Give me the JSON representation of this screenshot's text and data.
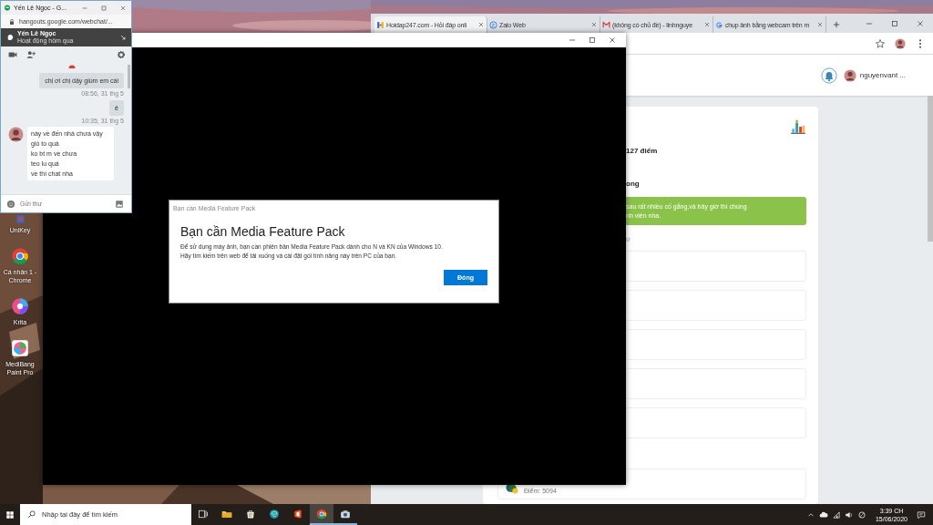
{
  "desktop": {
    "icons": [
      {
        "kind": "unikey",
        "label": "UniKey"
      },
      {
        "kind": "chrome",
        "label": "Cá nhân 1 - Chrome"
      },
      {
        "kind": "krita",
        "label": "Krita"
      },
      {
        "kind": "medibang",
        "label": "MediBang Paint Pro"
      }
    ]
  },
  "browser": {
    "tabs": [
      {
        "kind": "hoidap",
        "title": "Hoidap247.com - Hỏi đáp onli",
        "selected": true
      },
      {
        "kind": "zalo",
        "title": "Zalo Web",
        "selected": false
      },
      {
        "kind": "gmail",
        "title": "(không có chủ đề) - linhnguye",
        "selected": false
      },
      {
        "kind": "google",
        "title": "chụp ảnh bằng webcam trên m",
        "selected": false
      }
    ],
    "page": {
      "user_name": "nguyenvant ...",
      "score": "127 điểm",
      "heading": "ong",
      "alert_lines": [
        "sau rất nhiều cố gắng,và bây giờ thì chúng",
        "nh viên nha."
      ],
      "note": "ứ",
      "points": "Điểm: 5094"
    }
  },
  "camera": {
    "dialog": {
      "caption": "Bạn cần Media Feature Pack",
      "title": "Bạn cần Media Feature Pack",
      "body_lines": [
        "Để sử dụng máy ảnh, bạn cần phiên bản Media Feature Pack dành cho N và KN của Windows 10.",
        "Hãy tìm kiếm trên web để tải xuống và cài đặt gói tính năng này trên PC của bạn."
      ],
      "button": "Đóng"
    }
  },
  "hangouts": {
    "title": "Yến Lê Ngọc - G...",
    "url": "hangouts.google.com/webchat/...",
    "contact": "Yến Lê Ngọc",
    "status": "Hoạt động hôm qua",
    "messages": [
      {
        "kind": "sent",
        "lines": [
          "chị ơi chị dậy giùm em cái"
        ],
        "time": "08:56, 31 thg 5"
      },
      {
        "kind": "sent",
        "lines": [
          "ê"
        ],
        "time": "10:35, 31 thg 5"
      },
      {
        "kind": "received",
        "lines": [
          "này về đến nhà chưa vậy",
          "gió to quá",
          "ko bt m về chưa",
          "teo lu quá",
          "về thì chat nha"
        ]
      }
    ],
    "placeholder": "Gửi thư"
  },
  "taskbar": {
    "search_placeholder": "Nhập tại đây để tìm kiếm",
    "apps": [
      {
        "kind": "taskview",
        "open": false,
        "active": false
      },
      {
        "kind": "folder",
        "open": false,
        "active": false
      },
      {
        "kind": "store",
        "open": false,
        "active": false
      },
      {
        "kind": "edge",
        "open": false,
        "active": false
      },
      {
        "kind": "office",
        "open": false,
        "active": false
      },
      {
        "kind": "chrome",
        "open": true,
        "active": true
      },
      {
        "kind": "camera",
        "open": true,
        "active": false
      }
    ],
    "time": "3:39 CH",
    "date": "15/06/2020"
  }
}
